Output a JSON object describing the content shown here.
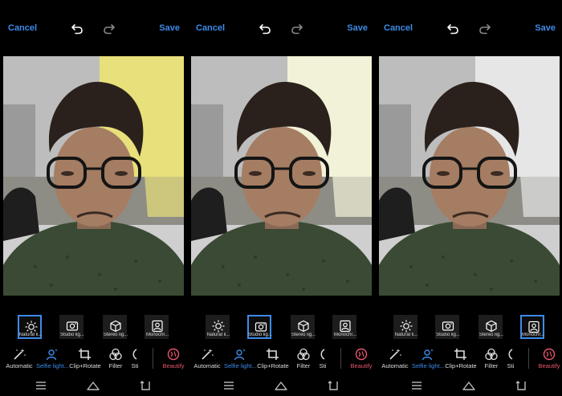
{
  "panels": [
    {
      "cancel": "Cancel",
      "save": "Save",
      "selected_filter": 0,
      "tint": "#e8e07a",
      "filters": [
        {
          "label": "Natural li...",
          "icon": "sun-icon"
        },
        {
          "label": "Studio lig...",
          "icon": "studio-light-icon"
        },
        {
          "label": "Stereo lig...",
          "icon": "cube-icon"
        },
        {
          "label": "Monochr...",
          "icon": "portrait-icon"
        }
      ],
      "tools": [
        {
          "label": "Automatic",
          "icon": "magic-wand-icon"
        },
        {
          "label": "Selfie light...",
          "icon": "selfie-light-icon"
        },
        {
          "label": "Clip+Rotate",
          "icon": "crop-icon"
        },
        {
          "label": "Filter",
          "icon": "filter-circles-icon"
        },
        {
          "label": "Sti",
          "icon": "sticker-icon"
        },
        {
          "label": "Beautify",
          "icon": "beautify-icon"
        }
      ]
    },
    {
      "cancel": "Cancel",
      "save": "Save",
      "selected_filter": 1,
      "tint": "#f2f2d8",
      "filters": [
        {
          "label": "Natural li...",
          "icon": "sun-icon"
        },
        {
          "label": "Studio lig...",
          "icon": "studio-light-icon"
        },
        {
          "label": "Stereo lig...",
          "icon": "cube-icon"
        },
        {
          "label": "Monochr...",
          "icon": "portrait-icon"
        }
      ],
      "tools": [
        {
          "label": "Automatic",
          "icon": "magic-wand-icon"
        },
        {
          "label": "Selfie light...",
          "icon": "selfie-light-icon"
        },
        {
          "label": "Clip+Rotate",
          "icon": "crop-icon"
        },
        {
          "label": "Filter",
          "icon": "filter-circles-icon"
        },
        {
          "label": "Sti",
          "icon": "sticker-icon"
        },
        {
          "label": "Beautify",
          "icon": "beautify-icon"
        }
      ]
    },
    {
      "cancel": "Cancel",
      "save": "Save",
      "selected_filter": 3,
      "tint": "#e6e6e6",
      "filters": [
        {
          "label": "Natural li...",
          "icon": "sun-icon"
        },
        {
          "label": "Studio lig...",
          "icon": "studio-light-icon"
        },
        {
          "label": "Stereo lig...",
          "icon": "cube-icon"
        },
        {
          "label": "Monochr...",
          "icon": "portrait-icon"
        }
      ],
      "tools": [
        {
          "label": "Automatic",
          "icon": "magic-wand-icon"
        },
        {
          "label": "Selfie light...",
          "icon": "selfie-light-icon"
        },
        {
          "label": "Clip+Rotate",
          "icon": "crop-icon"
        },
        {
          "label": "Filter",
          "icon": "filter-circles-icon"
        },
        {
          "label": "Sti",
          "icon": "sticker-icon"
        },
        {
          "label": "Beautify",
          "icon": "beautify-icon"
        }
      ]
    }
  ],
  "colors": {
    "accent": "#3d8be8",
    "beautify": "#e8566e",
    "background": "#000000"
  }
}
